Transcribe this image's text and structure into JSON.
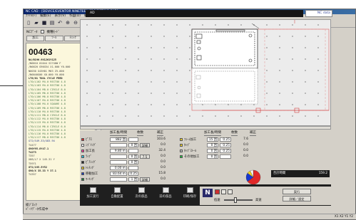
{
  "window": {
    "title": "NC CAD - [DEVICE/EVENTOR NINETEEN PROJECT/NC CAD]",
    "menu": [
      "ﾌｧｲﾙ(F)",
      "編集(E)",
      "表示(V)",
      "作図(D)",
      "編集2(M)",
      "計測(A)",
      "作成(C)",
      "設定(S)",
      "ﾍﾙﾌﾟ(H)"
    ],
    "toolbar_field_text": "AD",
    "toolbar_right_text": "NC data"
  },
  "left_panel": {
    "header_label": "NCﾃﾞｰﾀ",
    "checkbox_label": "機種ﾓｰﾄﾞ",
    "tabs": [
      "加工",
      "ﾂｰﾙ",
      "ﾁｪｯｸ",
      "ｸﾞﾙｰﾌﾟ"
    ],
    "program_number": "00463",
    "lines": [
      {
        "text": "N4/B196.9X1261Y125",
        "style": "dark"
      },
      {
        "text": "/N0010  01044   S2740W   F",
        "style": "normal"
      },
      {
        "text": "/N0020 G90G54 X1.000 Y0.000",
        "style": "normal"
      },
      {
        "text": "N0030 G43H01 M03 Z5.000",
        "style": "normal"
      },
      {
        "text": "/N0040G00 X0.000 Y0.000",
        "style": "normal"
      },
      {
        "text": "LT0/01   TOOL  CYCLE  FEED",
        "style": "dark"
      },
      {
        "text": "LT0/L102  M4.0 RECT86  4.8",
        "style": "green"
      },
      {
        "text": "LT0/L103  M4.0 RECT86  4.8",
        "style": "green"
      },
      {
        "text": "LT0/L104  M8.0 CIRCLE  8.0",
        "style": "green"
      },
      {
        "text": "LT0/L105  M6.0 RECT86  4.8",
        "style": "green"
      },
      {
        "text": "LT0/L106  M6.0 RECT86  4.8",
        "style": "green"
      },
      {
        "text": "LT0/L107  M4.0 RECT86  4.8",
        "style": "green"
      },
      {
        "text": "LT0/L108  M4.0 SQUARE  4.8",
        "style": "green"
      },
      {
        "text": "LT0/L109  M6.0 RECT86  4.8",
        "style": "green"
      },
      {
        "text": "LT0/L110  M4.0 RECT86  4.8",
        "style": "green"
      },
      {
        "text": "LT0/L111  M8.0 CIRCLE  8.0",
        "style": "green"
      },
      {
        "text": "LT0/L112  M4.0 RECT86  4.8",
        "style": "green"
      },
      {
        "text": "LT0/L113  M4.0 RECT86  4.8",
        "style": "green"
      },
      {
        "text": "LT0/L114  M6.0 CIRCLE  6.0",
        "style": "green"
      },
      {
        "text": "LT0/L115  M4.0 RECT86  4.8",
        "style": "green"
      },
      {
        "text": "LT0/L116  M4.0 RECT86  4.8",
        "style": "green"
      },
      {
        "text": "LT0/L117  M8.0 RECT86  4.8",
        "style": "green"
      },
      {
        "text": "G72/S49.33/X83.94",
        "style": "blue"
      },
      {
        "text": "T4477",
        "style": "normal"
      },
      {
        "text": "G90Y95.8Y47.1",
        "style": "dark"
      },
      {
        "text": "T4273",
        "style": "dark"
      },
      {
        "text": "T357",
        "style": "normal"
      },
      {
        "text": "X88/L7 X 145.31 Y",
        "style": "normal"
      },
      {
        "text": "T5971",
        "style": "normal"
      },
      {
        "text": "G72/195.5Y52",
        "style": "dark"
      },
      {
        "text": "G90/X 35.33 Y 37.1",
        "style": "dark"
      },
      {
        "text": "T4357",
        "style": "normal"
      }
    ],
    "status_line1": "総ﾌﾞﾛｯｸ",
    "status_line2": "ﾊﾟｰﾂﾃﾞｰﾀ作成中"
  },
  "bottom_panel": {
    "headers_left": [
      "加工長/時間",
      "枚数",
      "補正"
    ],
    "headers_right": [
      "加工長/時間",
      "枚数",
      "補正"
    ],
    "rows_left": [
      {
        "label": "ﾋﾟｱｽ",
        "value": "882 回",
        "count": "",
        "extra": "",
        "corr": "103.6",
        "color": "#d83030"
      },
      {
        "label": "ﾆﾌﾞﾘﾝｸﾞ",
        "value": "",
        "count": "0 回",
        "extra": "詳細",
        "corr": "0.0",
        "color": "#ffffff"
      },
      {
        "label": "加工長",
        "value": "9.80 m",
        "count": "",
        "extra": "",
        "corr": "32.4",
        "color": "#ff3ea0"
      },
      {
        "label": "ﾗｯﾌﾟ",
        "value": "",
        "count": "0 回",
        "extra": "7.5",
        "corr": "0.0",
        "color": "#30c0e0"
      },
      {
        "label": "ﾋﾟｱｼﾝｸﾞ",
        "value": "",
        "count": "0 回",
        "extra": "",
        "corr": "0.0",
        "color": "#2a2a2a"
      },
      {
        "label": "ﾄﾚﾁﾝｸﾞ",
        "value": "0.00 m",
        "count": "",
        "extra": "",
        "corr": "0.0",
        "color": "#f0d020"
      },
      {
        "label": "移動加工",
        "value": "83.64 m",
        "count": "0.25",
        "extra": "",
        "corr": "15.8",
        "color": "#2040c0"
      },
      {
        "label": "ﾏｰｷﾝｸﾞ",
        "value": "",
        "count": "1 回",
        "extra": "詳細",
        "corr": "0.0",
        "color": "#208040"
      }
    ],
    "rows_right": [
      {
        "label": "ﾌｫｰﾑ加工",
        "value": "15 回",
        "count": "0.25",
        "corr": "7.6",
        "color": "#f0d020"
      },
      {
        "label": "ﾀｯﾌﾟ",
        "value": "0 回",
        "count": "0.25",
        "corr": "0.0",
        "color": "#f0d020"
      },
      {
        "label": "ﾀｯﾌﾟｽﾄｰﾙ",
        "value": "0 回",
        "count": "0.25",
        "corr": "0.0",
        "color": "#c0c0c0"
      },
      {
        "label": "その他加工",
        "value": "0 回",
        "count": "",
        "corr": "0.0",
        "color": "#20c040"
      }
    ],
    "total_label": "合計時間",
    "total_value": "159.2",
    "pie": {
      "segments": [
        {
          "fraction": 0.65,
          "color": "#e02828"
        },
        {
          "fraction": 0.2,
          "color": "#1838d0"
        },
        {
          "fraction": 0.08,
          "color": "#f0d020"
        },
        {
          "fraction": 0.07,
          "color": "#f8f8f8"
        }
      ]
    }
  },
  "actions": [
    "加工実行",
    "自動配置",
    "次の部品",
    "前の部品",
    "印刷/保存"
  ],
  "widgets": {
    "slider_left": "低速",
    "slider_right": "高速",
    "button_top": "実行",
    "button_bottom": "詳細／設定"
  },
  "status_bar": {
    "coords": "X1  X2  Y1  Y2"
  }
}
